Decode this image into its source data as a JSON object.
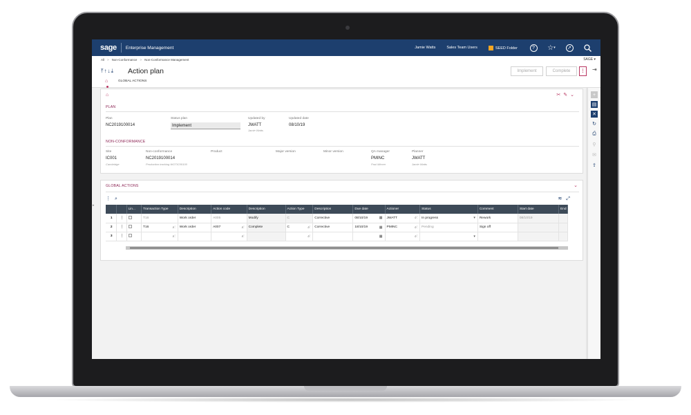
{
  "topbar": {
    "logo": "sage",
    "app_name": "Enterprise Management",
    "user": "Jamie Watts",
    "role": "Sales Team Users",
    "folder": "SEED Folder",
    "folder_color": "#f5a623",
    "icons": [
      "help-icon",
      "star-icon",
      "compass-icon",
      "search-icon"
    ]
  },
  "breadcrumb": {
    "items": [
      "All",
      "Non-Conformance",
      "Non-Conformance Management"
    ],
    "site": "SAGE"
  },
  "header": {
    "title": "Action plan",
    "implement_label": "Implement",
    "complete_label": "Complete",
    "more_label": "⋮",
    "tab_label": "GLOBAL ACTIONS"
  },
  "plan": {
    "section_title": "PLAN",
    "plan_label": "Plan",
    "plan_value": "NC2019100014",
    "status_label": "Status plan",
    "status_value": "Implement",
    "updated_by_label": "Updated by",
    "updated_by_value": "JWATT",
    "updated_by_name": "Jamie Watts",
    "updated_date_label": "Updated date",
    "updated_date_value": "08/10/19"
  },
  "nonconformance": {
    "section_title": "NON-CONFORMANCE",
    "site_label": "Site",
    "site_value": "IC001",
    "site_sub": "Cambridge",
    "nc_label": "Non-conformance",
    "nc_value": "NC2019100014",
    "nc_sub": "Production tracking WOTIC00100",
    "product_label": "Product",
    "major_label": "Major version",
    "minor_label": "Minor version",
    "qa_label": "QA manager",
    "qa_value": "PMINC",
    "qa_sub": "Paul Mincer",
    "planner_label": "Planner",
    "planner_value": "JWATT",
    "planner_sub": "Jamie Watts"
  },
  "global_actions": {
    "section_title": "GLOBAL ACTIONS",
    "columns": [
      "Lin...",
      "Transaction Type",
      "Description",
      "Action code",
      "Description",
      "Action Type",
      "Description",
      "Due date",
      "Actioner",
      "Status",
      "Comment",
      "Start date",
      "End date",
      "Orde"
    ],
    "rows": [
      {
        "num": "1",
        "trans": "T16",
        "desc1": "Work order",
        "code": "A005",
        "desc2": "Modify",
        "atype": "C",
        "desc3": "Corrective",
        "due": "08/10/19",
        "actioner": "JWATT",
        "status": "In progress",
        "comment": "Rework",
        "start": "08/10/19",
        "end": ""
      },
      {
        "num": "2",
        "trans": "T16",
        "desc1": "Work order",
        "code": "A007",
        "desc2": "Complete",
        "atype": "C",
        "desc3": "Corrective",
        "due": "18/10/19",
        "actioner": "PMINC",
        "status": "Pending",
        "comment": "Sign off",
        "start": "",
        "end": ""
      },
      {
        "num": "3",
        "trans": "",
        "desc1": "",
        "code": "",
        "desc2": "",
        "atype": "",
        "desc3": "",
        "due": "",
        "actioner": "",
        "status": "",
        "comment": "",
        "start": "",
        "end": ""
      }
    ]
  },
  "colors": {
    "topbar": "#1d3f6e",
    "accent": "#b8335f",
    "grid_header": "#3d4a58"
  }
}
